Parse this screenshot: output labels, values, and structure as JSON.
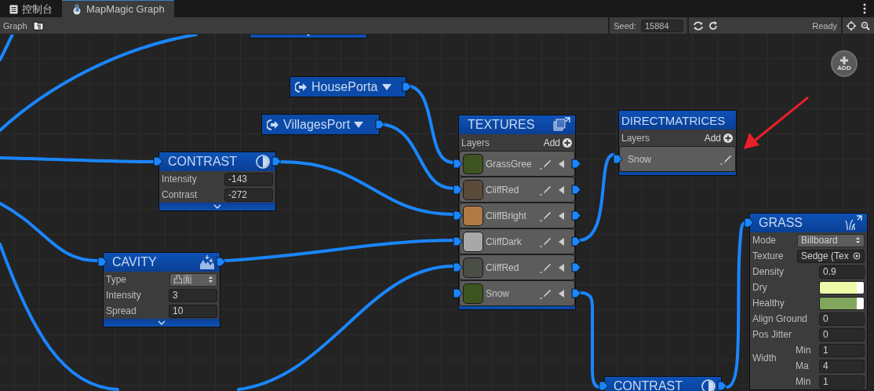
{
  "tabs": [
    {
      "label": "控制台",
      "kind": "console",
      "selected": false
    },
    {
      "label": "MapMagic Graph",
      "kind": "graph",
      "selected": true
    }
  ],
  "toolbar": {
    "title": "Graph",
    "seed_label": "Seed:",
    "seed": "15884",
    "status": "Ready"
  },
  "graph": {
    "add_button": "ADD",
    "nodes": [
      {
        "kind": "stub"
      },
      {
        "kind": "portal",
        "title": "HousePorta"
      },
      {
        "kind": "portal",
        "title": "VillagesPort"
      },
      {
        "kind": "textures",
        "title": "TEXTURES",
        "layers_label": "Layers",
        "add_label": "Add",
        "layers": [
          {
            "name": "GrassGree",
            "color": "#3d5420"
          },
          {
            "name": "CliffRed",
            "color": "#5a4a3a"
          },
          {
            "name": "CliffBright",
            "color": "#b07a45"
          },
          {
            "name": "CliffDark",
            "color": "#a8a8a8"
          },
          {
            "name": "CliffRed",
            "color": "#4a4e46"
          },
          {
            "name": "Snow",
            "color": "#3d5420"
          }
        ]
      },
      {
        "kind": "directmatrices",
        "title": "DIRECTMATRICES",
        "layers_label": "Layers",
        "add_label": "Add",
        "layers": [
          {
            "name": "Snow"
          }
        ]
      },
      {
        "kind": "contrast",
        "title": "CONTRAST",
        "fields": [
          {
            "kind": "number",
            "label": "Intensity",
            "value": "-143"
          },
          {
            "kind": "number",
            "label": "Contrast",
            "value": "-272"
          }
        ]
      },
      {
        "kind": "cavity",
        "title": "CAVITY",
        "fields": [
          {
            "kind": "dropdown",
            "label": "Type",
            "value": "凸面"
          },
          {
            "kind": "number",
            "label": "Intensity",
            "value": "3"
          },
          {
            "kind": "number",
            "label": "Spread",
            "value": "10"
          }
        ]
      },
      {
        "kind": "grass",
        "title": "GRASS",
        "fields": [
          {
            "kind": "dropdown",
            "label": "Mode",
            "value": "Billboard"
          },
          {
            "kind": "object",
            "label": "Texture",
            "value": "Sedge (Tex"
          },
          {
            "kind": "number",
            "label": "Density",
            "value": "0.9"
          },
          {
            "kind": "color",
            "label": "Dry",
            "color": "#eefaa8"
          },
          {
            "kind": "color",
            "label": "Healthy",
            "color": "#81a65c"
          },
          {
            "kind": "number",
            "label": "Align Ground",
            "value": "0"
          },
          {
            "kind": "number",
            "label": "Pos Jitter",
            "value": "0"
          },
          {
            "kind": "range",
            "label": "Width",
            "parts": [
              {
                "label": "Min",
                "value": "1"
              },
              {
                "label": "Ma",
                "value": "4"
              }
            ]
          },
          {
            "kind": "range",
            "parts": [
              {
                "label": "Min",
                "value": "1"
              }
            ]
          }
        ]
      },
      {
        "kind": "contrast",
        "title": "CONTRAST"
      }
    ]
  }
}
